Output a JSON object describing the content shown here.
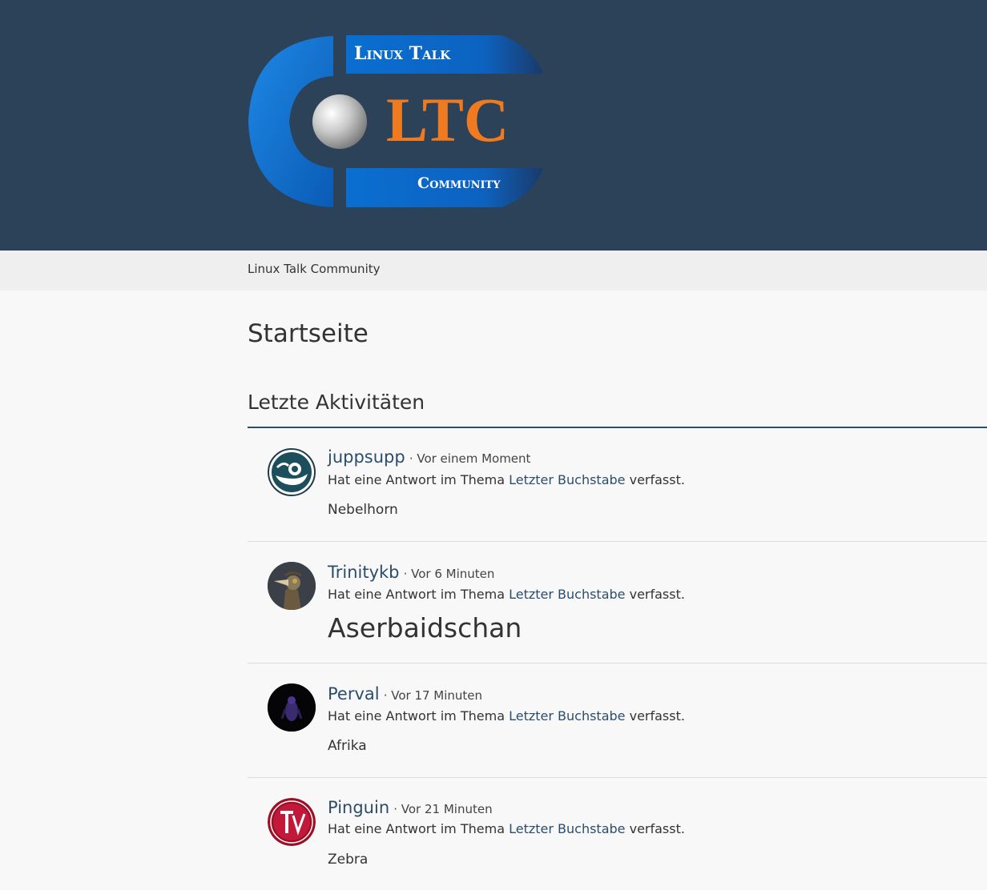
{
  "header": {
    "logo": {
      "top_text": "Linux Talk",
      "main_text": "LTC",
      "bottom_text": "Community",
      "colors": {
        "blue": "#0a6fd1",
        "orange": "#f07a1f",
        "background": "#2b4259"
      }
    }
  },
  "breadcrumb": {
    "label": "Linux Talk Community"
  },
  "page": {
    "title": "Startseite",
    "section_title": "Letzte Aktivitäten"
  },
  "activities": [
    {
      "user": "juppsupp",
      "time": "· Vor einem Moment",
      "prefix": "Hat eine Antwort im Thema",
      "topic": "Letzter Buchstabe",
      "suffix": "verfasst.",
      "content": "Nebelhorn",
      "avatar_icon": "opensuse-chameleon-icon"
    },
    {
      "user": "Trinitykb",
      "time": "· Vor 6 Minuten",
      "prefix": "Hat eine Antwort im Thema",
      "topic": "Letzter Buchstabe",
      "suffix": "verfasst.",
      "content": "Aserbaidschan",
      "avatar_icon": "plague-doctor-icon"
    },
    {
      "user": "Perval",
      "time": "· Vor 17 Minuten",
      "prefix": "Hat eine Antwort im Thema",
      "topic": "Letzter Buchstabe",
      "suffix": "verfasst.",
      "content": "Afrika",
      "avatar_icon": "purple-figure-icon"
    },
    {
      "user": "Pinguin",
      "time": "· Vor 21 Minuten",
      "prefix": "Hat eine Antwort im Thema",
      "topic": "Letzter Buchstabe",
      "suffix": "verfasst.",
      "content": "Zebra",
      "avatar_icon": "tux-monogram-icon"
    }
  ]
}
